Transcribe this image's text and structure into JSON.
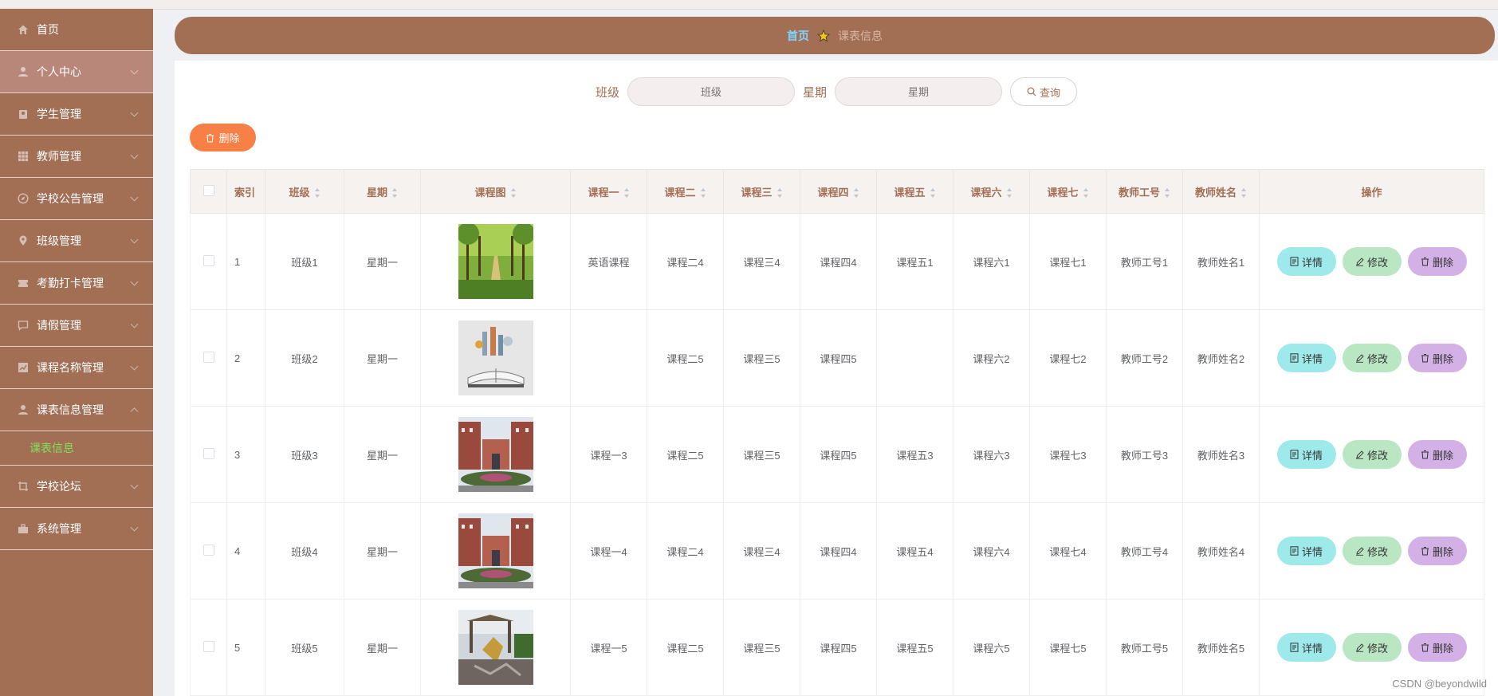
{
  "sidebar": {
    "items": [
      {
        "label": "首页",
        "icon": "home-icon",
        "active": false
      },
      {
        "label": "个人中心",
        "icon": "user-icon",
        "active": true
      },
      {
        "label": "学生管理",
        "icon": "student-icon",
        "active": false
      },
      {
        "label": "教师管理",
        "icon": "grid-icon",
        "active": false
      },
      {
        "label": "学校公告管理",
        "icon": "compass-icon",
        "active": false
      },
      {
        "label": "班级管理",
        "icon": "location-icon",
        "active": false
      },
      {
        "label": "考勤打卡管理",
        "icon": "ticket-icon",
        "active": false
      },
      {
        "label": "请假管理",
        "icon": "chat-icon",
        "active": false
      },
      {
        "label": "课程名称管理",
        "icon": "chart-icon",
        "active": false
      },
      {
        "label": "课表信息管理",
        "icon": "user-icon",
        "active": false
      }
    ],
    "sub_item": {
      "label": "课表信息"
    },
    "items_after": [
      {
        "label": "学校论坛",
        "icon": "crop-icon"
      },
      {
        "label": "系统管理",
        "icon": "toolbox-icon"
      }
    ]
  },
  "breadcrumb": {
    "home": "首页",
    "current": "课表信息"
  },
  "search": {
    "class_label": "班级",
    "class_placeholder": "班级",
    "weekday_label": "星期",
    "weekday_placeholder": "星期",
    "query_button": "查询"
  },
  "toolbar": {
    "delete_label": "删除"
  },
  "table": {
    "headers": [
      "索引",
      "班级",
      "星期",
      "课程图",
      "课程一",
      "课程二",
      "课程三",
      "课程四",
      "课程五",
      "课程六",
      "课程七",
      "教师工号",
      "教师姓名",
      "操作"
    ],
    "rows": [
      {
        "index": "1",
        "class": "班级1",
        "weekday": "星期一",
        "image": "tree-avenue",
        "c1": "英语课程",
        "c2": "课程二4",
        "c3": "课程三4",
        "c4": "课程四4",
        "c5": "课程五1",
        "c6": "课程六1",
        "c7": "课程七1",
        "teacher_id": "教师工号1",
        "teacher_name": "教师姓名1"
      },
      {
        "index": "2",
        "class": "班级2",
        "weekday": "星期一",
        "image": "book-city",
        "c1": "",
        "c2": "课程二5",
        "c3": "课程三5",
        "c4": "课程四5",
        "c5": "",
        "c6": "课程六2",
        "c7": "课程七2",
        "teacher_id": "教师工号2",
        "teacher_name": "教师姓名2"
      },
      {
        "index": "3",
        "class": "班级3",
        "weekday": "星期一",
        "image": "campus-building",
        "c1": "课程一3",
        "c2": "课程二5",
        "c3": "课程三5",
        "c4": "课程四5",
        "c5": "课程五3",
        "c6": "课程六3",
        "c7": "课程七3",
        "teacher_id": "教师工号3",
        "teacher_name": "教师姓名3"
      },
      {
        "index": "4",
        "class": "班级4",
        "weekday": "星期一",
        "image": "campus-building",
        "c1": "课程一4",
        "c2": "课程二4",
        "c3": "课程三4",
        "c4": "课程四4",
        "c5": "课程五4",
        "c6": "课程六4",
        "c7": "课程七4",
        "teacher_id": "教师工号4",
        "teacher_name": "教师姓名4"
      },
      {
        "index": "5",
        "class": "班级5",
        "weekday": "星期一",
        "image": "pavilion-sculpture",
        "c1": "课程一5",
        "c2": "课程二5",
        "c3": "课程三5",
        "c4": "课程四5",
        "c5": "课程五5",
        "c6": "课程六5",
        "c7": "课程七5",
        "teacher_id": "教师工号5",
        "teacher_name": "教师姓名5"
      }
    ],
    "actions": {
      "detail": "详情",
      "edit": "修改",
      "delete": "删除"
    }
  },
  "watermark": "CSDN @beyondwild",
  "colors": {
    "theme": "#a26f55",
    "accent_blue": "#7fd6ff",
    "submenu_green": "#82e05a",
    "delete_orange": "#f78046",
    "detail_cyan": "#9eeaea",
    "edit_green": "#b9e7c4",
    "remove_purple": "#d3b0e6"
  }
}
